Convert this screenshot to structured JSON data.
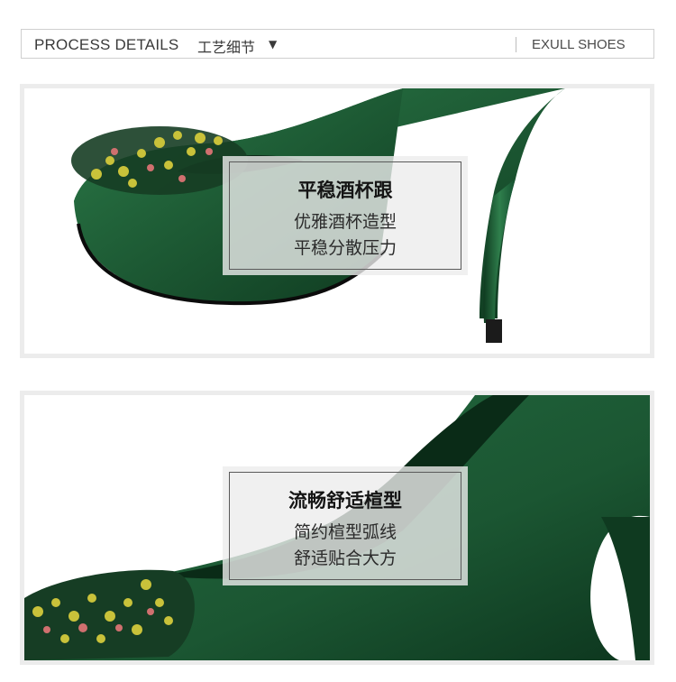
{
  "header": {
    "title_en": "PROCESS DETAILS",
    "title_cn": "工艺细节",
    "arrow_icon": "▼",
    "brand": "EXULL SHOES"
  },
  "panels": [
    {
      "title": "平稳酒杯跟",
      "line1": "优雅酒杯造型",
      "line2": "平稳分散压力"
    },
    {
      "title": "流畅舒适楦型",
      "line1": "简约楦型弧线",
      "line2": "舒适贴合大方"
    }
  ],
  "colors": {
    "shoe_green": "#1d5a34",
    "jewel_yellow": "#c9c23a",
    "jewel_pink": "#d0706f"
  }
}
